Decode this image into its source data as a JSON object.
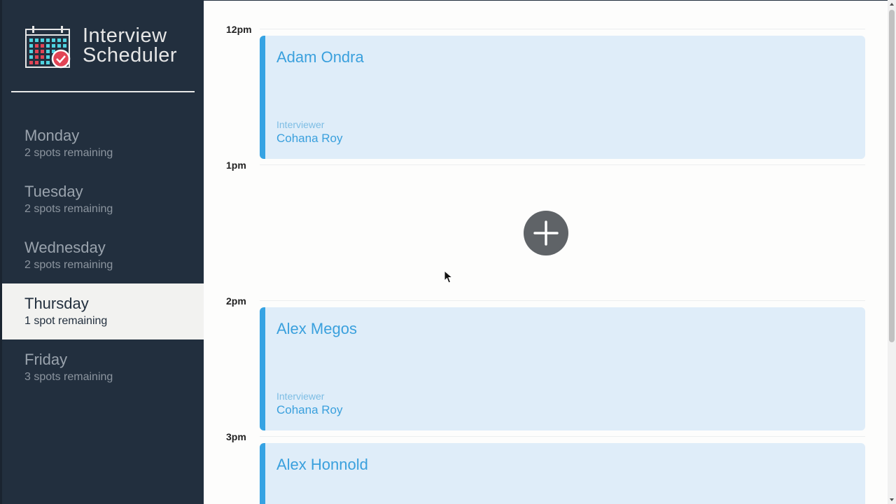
{
  "brand": {
    "title_line1": "Interview",
    "title_line2": "Scheduler",
    "logo_icon": "calendar-check-icon"
  },
  "sidebar": {
    "days": [
      {
        "name": "Monday",
        "spots": "2 spots remaining",
        "selected": false
      },
      {
        "name": "Tuesday",
        "spots": "2 spots remaining",
        "selected": false
      },
      {
        "name": "Wednesday",
        "spots": "2 spots remaining",
        "selected": false
      },
      {
        "name": "Thursday",
        "spots": "1 spot remaining",
        "selected": true
      },
      {
        "name": "Friday",
        "spots": "3 spots remaining",
        "selected": false
      }
    ]
  },
  "schedule": {
    "slots": [
      {
        "time": "12pm",
        "student": "Adam Ondra",
        "interviewer_label": "Interviewer",
        "interviewer": "Cohana Roy"
      },
      {
        "time": "1pm",
        "empty": true,
        "add_icon": "plus-icon"
      },
      {
        "time": "2pm",
        "student": "Alex Megos",
        "interviewer_label": "Interviewer",
        "interviewer": "Cohana Roy"
      },
      {
        "time": "3pm",
        "student": "Alex Honnold"
      }
    ]
  },
  "colors": {
    "sidebar_bg": "#222f3e",
    "selected_day_bg": "#f2f2f0",
    "appointment_bg": "#dfedf9",
    "appointment_accent": "#36a3e3",
    "add_button": "#5f6367"
  }
}
